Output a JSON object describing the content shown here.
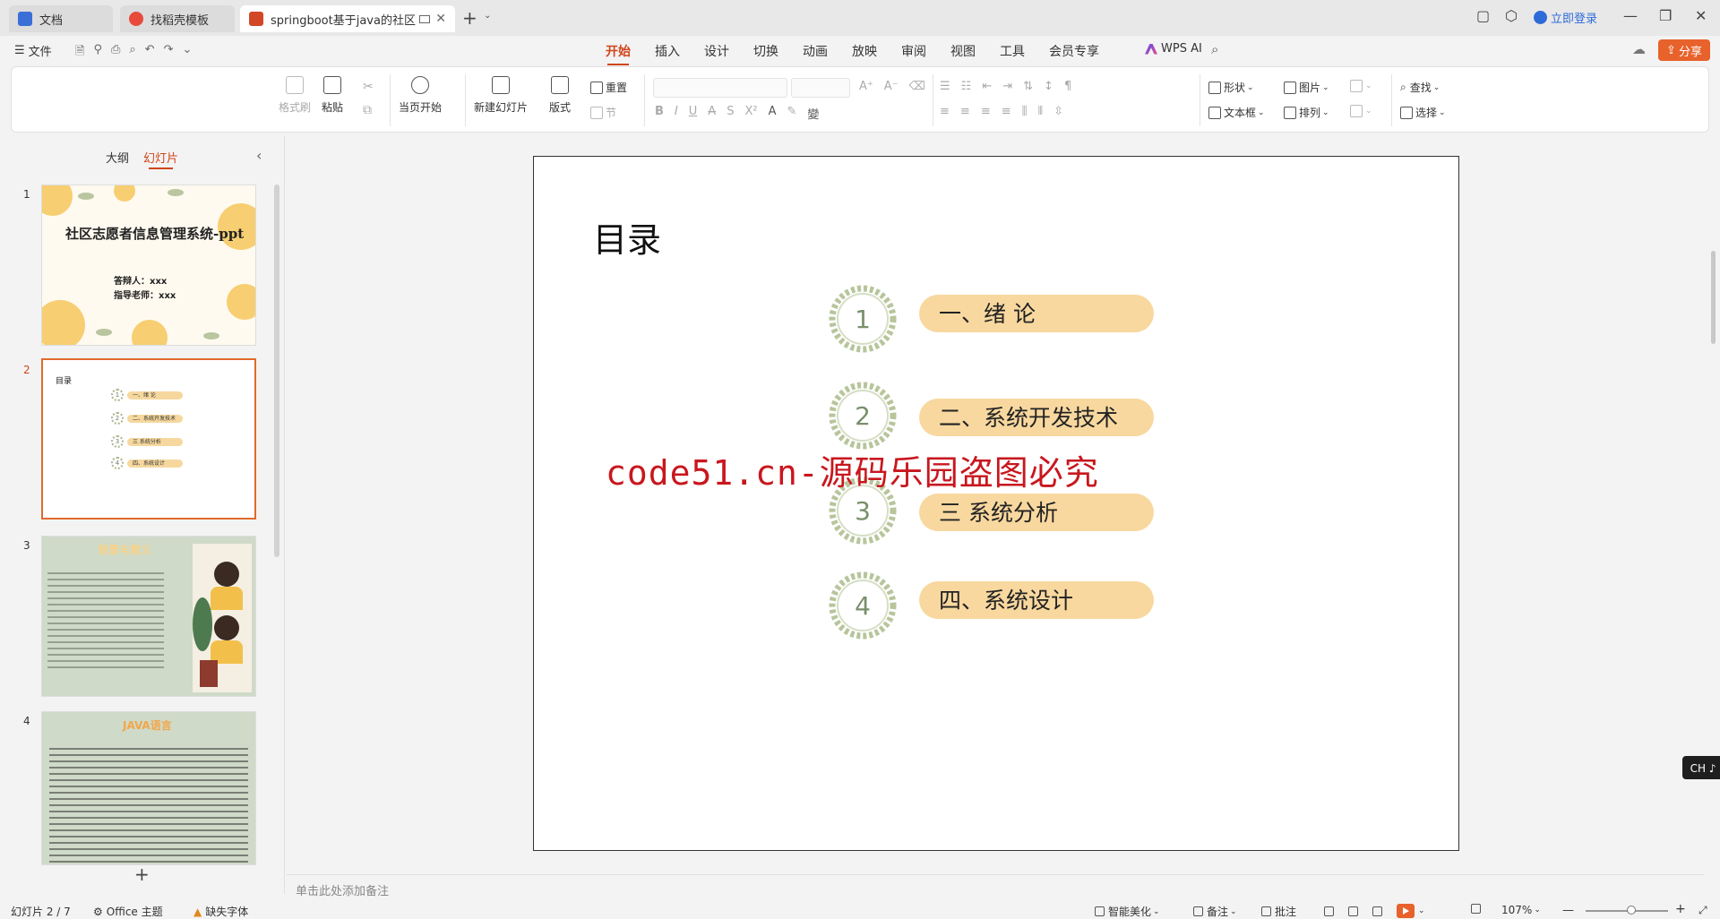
{
  "titlebar": {
    "tabs": [
      {
        "label": "文档",
        "icon": "doc-icon",
        "color": "#3b6fd8"
      },
      {
        "label": "找稻壳模板",
        "icon": "daoke-icon",
        "color": "#e84a3c"
      },
      {
        "label": "springboot基于java的社区志",
        "icon": "ppt-icon",
        "color": "#d24726"
      }
    ],
    "login": "立即登录"
  },
  "menubar": {
    "file": "文件",
    "tabs": [
      "开始",
      "插入",
      "设计",
      "切换",
      "动画",
      "放映",
      "审阅",
      "视图",
      "工具",
      "会员专享"
    ],
    "active_tab": "开始",
    "wps_ai": "WPS AI",
    "share": "分享"
  },
  "ribbon": {
    "format_painter": "格式刷",
    "paste": "粘贴",
    "start_from_current": "当页开始",
    "new_slide": "新建幻灯片",
    "layout": "版式",
    "reset": "重置",
    "section": "节",
    "shape": "形状",
    "picture": "图片",
    "textbox": "文本框",
    "arrange": "排列",
    "find": "查找",
    "select": "选择"
  },
  "leftpanel": {
    "tabs": [
      "大纲",
      "幻灯片"
    ],
    "active_tab": "幻灯片",
    "slides": [
      {
        "num": "1",
        "title": "社区志愿者信息管理系统-ppt",
        "presenter": "答辩人：xxx",
        "advisor": "指导老师：xxx"
      },
      {
        "num": "2",
        "title": "目录",
        "items": [
          "一、绪 论",
          "二、系统开发技术",
          "三 系统分析",
          "四、系统设计"
        ]
      },
      {
        "num": "3",
        "title": "背景与意义"
      },
      {
        "num": "4",
        "title": "JAVA语言"
      }
    ]
  },
  "slide": {
    "title": "目录",
    "items": [
      {
        "num": "1",
        "label": "一、绪  论"
      },
      {
        "num": "2",
        "label": "二、系统开发技术"
      },
      {
        "num": "3",
        "label": "三    系统分析"
      },
      {
        "num": "4",
        "label": "四、系统设计"
      }
    ],
    "watermark": "code51.cn-源码乐园盗图必究"
  },
  "notes_placeholder": "单击此处添加备注",
  "ime": "CH ♪ 简",
  "statusbar": {
    "slide_counter": "幻灯片 2 / 7",
    "theme": "Office 主题",
    "missing_font": "缺失字体",
    "smart_beautify": "智能美化",
    "notes": "备注",
    "comments": "批注",
    "zoom": "107%"
  }
}
